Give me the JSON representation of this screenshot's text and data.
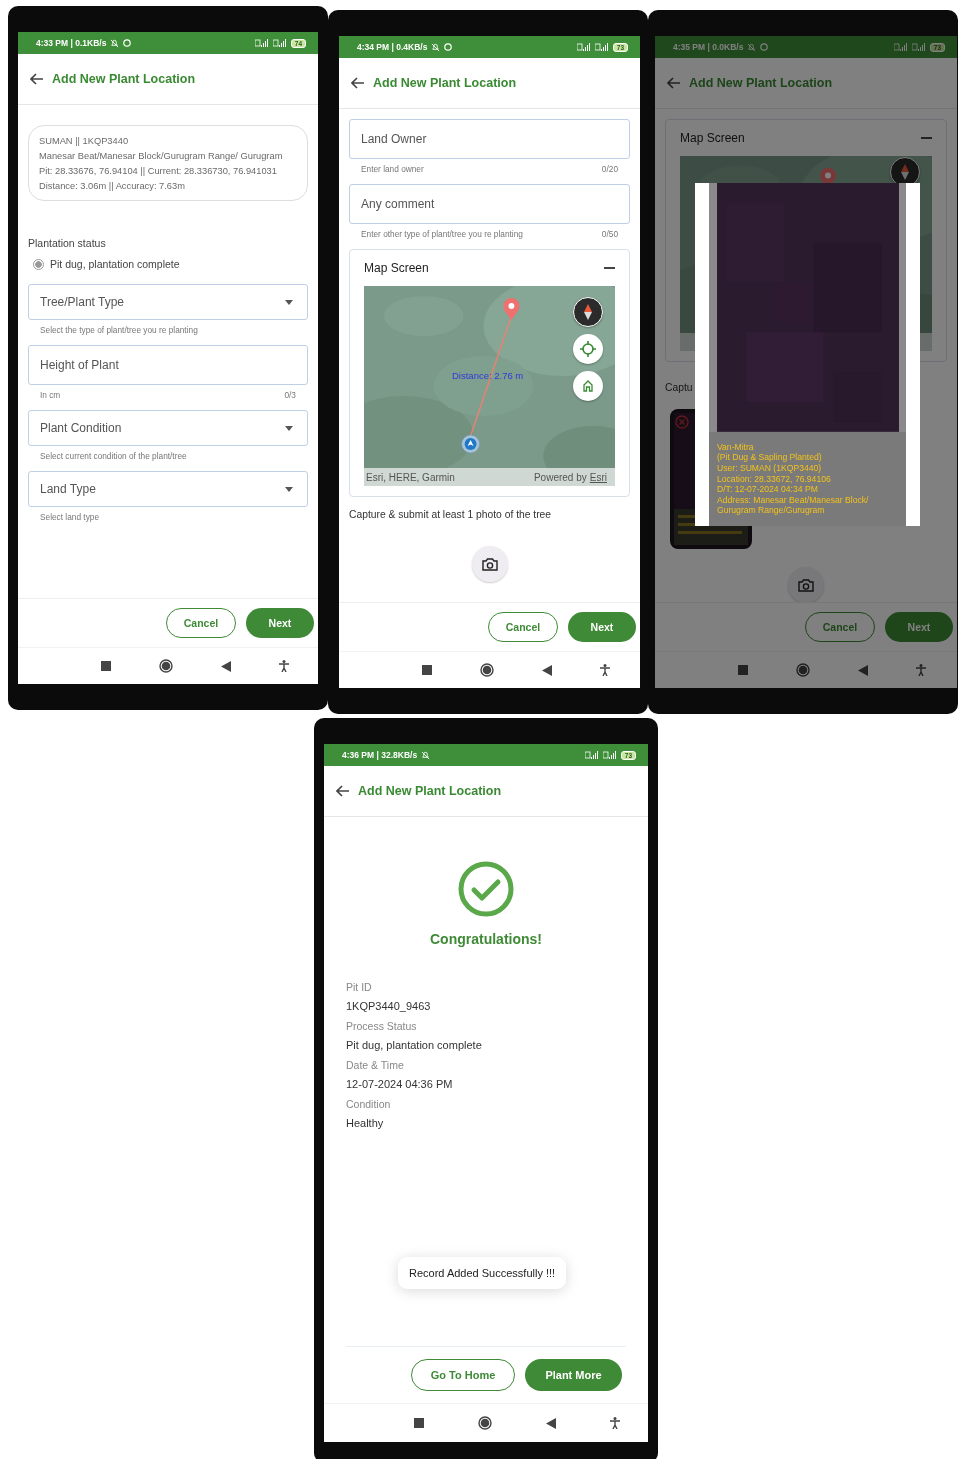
{
  "screens": [
    {
      "kind": "form",
      "status_bar": {
        "time": "4:33 PM | 0.1KB/s",
        "battery": "74"
      },
      "title": "Add New Plant Location",
      "info_card": [
        "SUMAN || 1KQP3440",
        "Manesar Beat/Manesar Block/Gurugram  Range/ Gurugram",
        "Pit: 28.33676, 76.94104 || Current: 28.336730, 76.941031",
        "Distance: 3.06m || Accuracy: 7.63m"
      ],
      "plantation_status": {
        "label": "Plantation status",
        "options": [
          {
            "label": "Pit dug, plantation complete",
            "selected": true
          }
        ]
      },
      "fields": [
        {
          "kind": "dropdown",
          "label": "Tree/Plant Type",
          "helper": "Select the type of plant/tree you re planting"
        },
        {
          "kind": "text",
          "label": "Height of Plant",
          "helper": "In cm",
          "counter": "0/3"
        },
        {
          "kind": "dropdown",
          "label": "Plant Condition",
          "helper": "Select current condition of the plant/tree"
        },
        {
          "kind": "dropdown",
          "label": "Land Type",
          "helper": "Select land type"
        }
      ],
      "buttons": [
        {
          "kind": "outline",
          "label": "Cancel"
        },
        {
          "kind": "filled",
          "label": "Next"
        }
      ]
    },
    {
      "kind": "form",
      "status_bar": {
        "time": "4:34 PM | 0.4KB/s",
        "battery": "73"
      },
      "title": "Add New Plant Location",
      "fields": [
        {
          "kind": "text",
          "label": "Land Owner",
          "helper": "Enter land owner",
          "counter": "0/20"
        },
        {
          "kind": "text",
          "label": "Any comment",
          "helper": "Enter other type of plant/tree you re planting",
          "counter": "0/50"
        }
      ],
      "map_card": {
        "title": "Map Screen",
        "distance": "Distance: 2.76 m",
        "attribution": "Esri, HERE, Garmin",
        "powered_by": "Powered by",
        "powered_link": "Esri"
      },
      "photo_note": "Capture & submit at least 1 photo of the tree",
      "buttons": [
        {
          "kind": "outline",
          "label": "Cancel"
        },
        {
          "kind": "filled",
          "label": "Next"
        }
      ]
    },
    {
      "kind": "form",
      "status_bar": {
        "time": "4:35 PM | 0.0KB/s",
        "battery": "73"
      },
      "title": "Add New Plant Location",
      "map_card": {
        "title": "Map Screen"
      },
      "photo_note": "Captu",
      "photo_dialog": {
        "caption": [
          "Van-Mitra",
          "(Pit Dug & Sapling Planted)",
          "User: SUMAN (1KQP3440)",
          "Location: 28.33672, 76.94106",
          "D/T: 12-07-2024 04:34 PM",
          "Address: Manesar Beat/Manesar Block/ Gurugram  Range/Gurugram"
        ]
      },
      "buttons": [
        {
          "kind": "outline",
          "label": "Cancel"
        },
        {
          "kind": "filled",
          "label": "Next"
        }
      ]
    },
    {
      "kind": "success",
      "status_bar": {
        "time": "4:36 PM | 32.8KB/s",
        "battery": "73"
      },
      "title": "Add New Plant Location",
      "heading": "Congratulations!",
      "details": [
        {
          "label": "Pit ID",
          "value": "1KQP3440_9463"
        },
        {
          "label": "Process Status",
          "value": "Pit dug, plantation complete"
        },
        {
          "label": "Date & Time",
          "value": "12-07-2024 04:36 PM"
        },
        {
          "label": "Condition",
          "value": "Healthy"
        }
      ],
      "toast": "Record Added Successfully !!!",
      "buttons": [
        {
          "kind": "outline",
          "label": "Go To Home"
        },
        {
          "kind": "filled",
          "label": "Plant More"
        }
      ]
    }
  ]
}
